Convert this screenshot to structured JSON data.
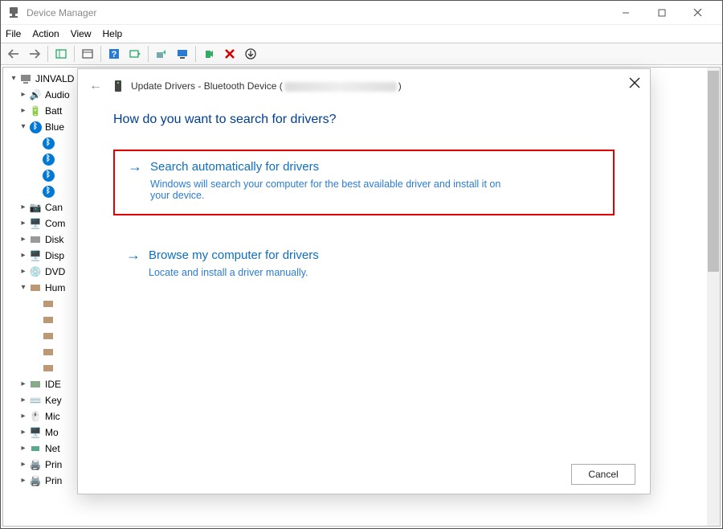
{
  "window": {
    "title": "Device Manager"
  },
  "menu": {
    "file": "File",
    "action": "Action",
    "view": "View",
    "help": "Help"
  },
  "tree": {
    "root": "JINVALD",
    "items": [
      {
        "label": "Audio",
        "icon": "speaker"
      },
      {
        "label": "Batt",
        "icon": "battery"
      },
      {
        "label": "Blue",
        "icon": "bluetooth",
        "expanded": true
      },
      {
        "label": "Can",
        "icon": "camera"
      },
      {
        "label": "Com",
        "icon": "monitor"
      },
      {
        "label": "Disk",
        "icon": "disk"
      },
      {
        "label": "Disp",
        "icon": "display"
      },
      {
        "label": "DVD",
        "icon": "dvd"
      },
      {
        "label": "Hum",
        "icon": "hid",
        "expanded": true
      },
      {
        "label": "IDE",
        "icon": "ide"
      },
      {
        "label": "Key",
        "icon": "keyboard"
      },
      {
        "label": "Mic",
        "icon": "mouse"
      },
      {
        "label": "Mo",
        "icon": "monitor"
      },
      {
        "label": "Net",
        "icon": "network"
      },
      {
        "label": "Prin",
        "icon": "printer"
      },
      {
        "label": "Prin",
        "icon": "printer"
      }
    ]
  },
  "dialog": {
    "title_prefix": "Update Drivers - Bluetooth Device (",
    "title_suffix": ")",
    "heading": "How do you want to search for drivers?",
    "option1": {
      "title": "Search automatically for drivers",
      "desc": "Windows will search your computer for the best available driver and install it on your device."
    },
    "option2": {
      "title": "Browse my computer for drivers",
      "desc": "Locate and install a driver manually."
    },
    "cancel": "Cancel"
  }
}
